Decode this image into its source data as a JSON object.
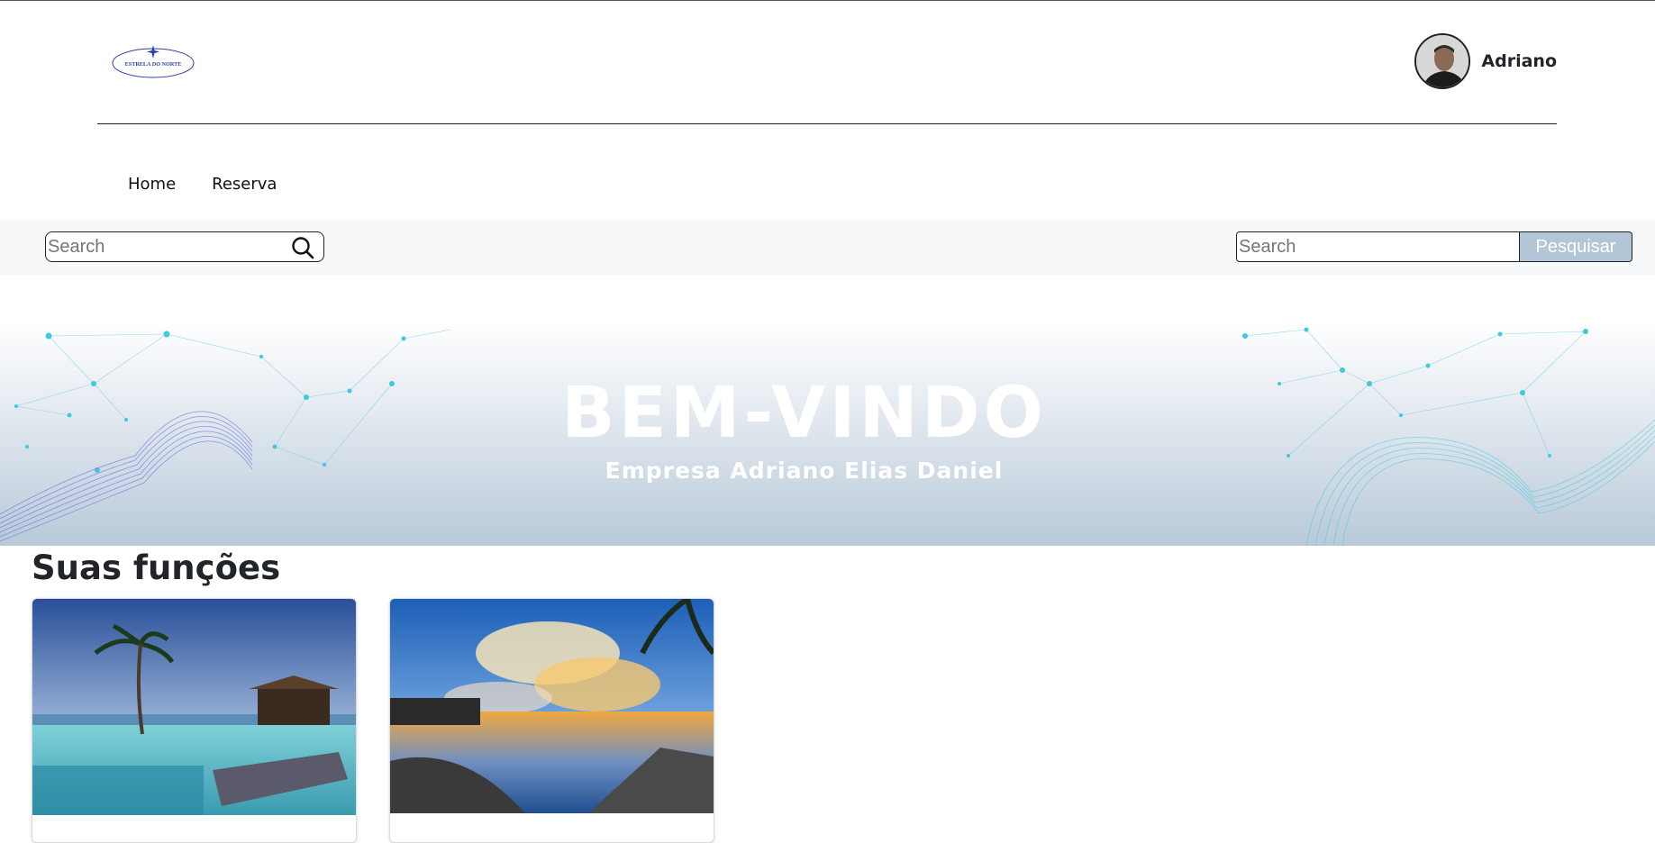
{
  "header": {
    "logo_text": "ESTRELA DO NORTE",
    "user_name": "Adriano"
  },
  "nav": {
    "items": [
      {
        "label": "Home"
      },
      {
        "label": "Reserva"
      }
    ]
  },
  "search_left": {
    "placeholder": "Search",
    "icon": "search-icon"
  },
  "search_right": {
    "placeholder": "Search",
    "button_label": "Pesquisar"
  },
  "banner": {
    "title": "BEM-VINDO",
    "subtitle": "Empresa Adriano Elias Daniel"
  },
  "section": {
    "title": "Suas funções",
    "cards": [
      {
        "image": "resort-pool-image"
      },
      {
        "image": "sunset-pool-image"
      }
    ]
  },
  "colors": {
    "accent_button": "#b3c6d8",
    "search_band": "#f7f8fa"
  }
}
